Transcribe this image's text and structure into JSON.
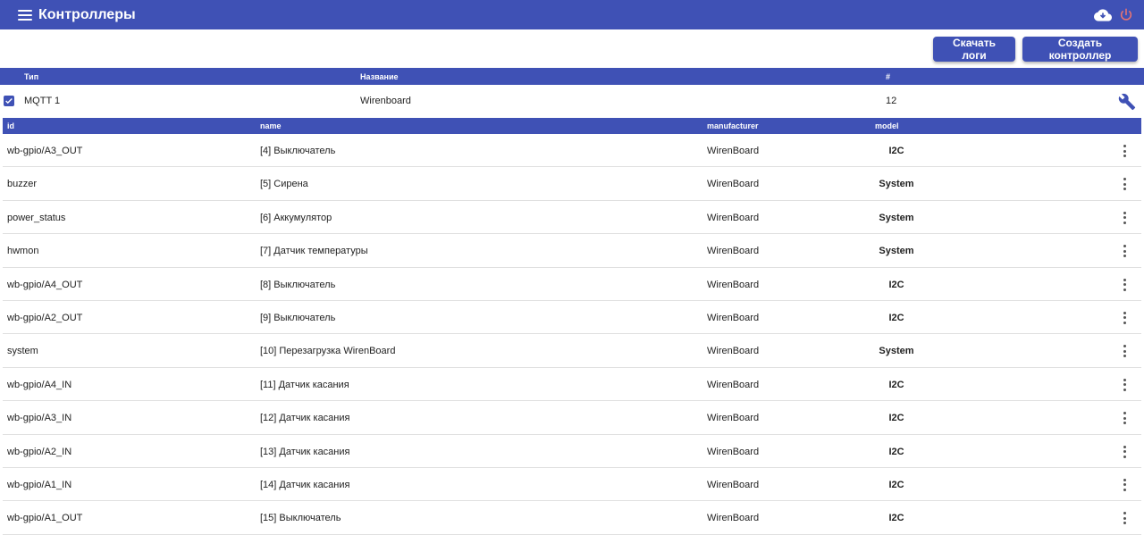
{
  "appbar": {
    "title": "Контроллеры",
    "icons": [
      "menu-icon",
      "cloud-download-icon",
      "power-icon"
    ],
    "colors": {
      "primary": "#3f51b5",
      "power": "#e57373"
    }
  },
  "toolbar": {
    "download_logs_label": "Скачать логи",
    "create_controller_label": "Создать контроллер"
  },
  "controllers": {
    "headers": {
      "type": "Тип",
      "name": "Название",
      "number": "#"
    },
    "rows": [
      {
        "checked": true,
        "type": "MQTT 1",
        "name": "Wirenboard",
        "number": "12",
        "action_icon": "wrench-icon"
      }
    ]
  },
  "devices": {
    "headers": {
      "id": "id",
      "name": "name",
      "manufacturer": "manufacturer",
      "model": "model"
    },
    "rows": [
      {
        "id": "wb-gpio/A3_OUT",
        "name": "[4] Выключатель",
        "manufacturer": "WirenBoard",
        "model": "I2C"
      },
      {
        "id": "buzzer",
        "name": "[5] Сирена",
        "manufacturer": "WirenBoard",
        "model": "System"
      },
      {
        "id": "power_status",
        "name": "[6] Аккумулятор",
        "manufacturer": "WirenBoard",
        "model": "System"
      },
      {
        "id": "hwmon",
        "name": "[7] Датчик температуры",
        "manufacturer": "WirenBoard",
        "model": "System"
      },
      {
        "id": "wb-gpio/A4_OUT",
        "name": "[8] Выключатель",
        "manufacturer": "WirenBoard",
        "model": "I2C"
      },
      {
        "id": "wb-gpio/A2_OUT",
        "name": "[9] Выключатель",
        "manufacturer": "WirenBoard",
        "model": "I2C"
      },
      {
        "id": "system",
        "name": "[10] Перезагрузка WirenBoard",
        "manufacturer": "WirenBoard",
        "model": "System"
      },
      {
        "id": "wb-gpio/A4_IN",
        "name": "[11] Датчик касания",
        "manufacturer": "WirenBoard",
        "model": "I2C"
      },
      {
        "id": "wb-gpio/A3_IN",
        "name": "[12] Датчик касания",
        "manufacturer": "WirenBoard",
        "model": "I2C"
      },
      {
        "id": "wb-gpio/A2_IN",
        "name": "[13] Датчик касания",
        "manufacturer": "WirenBoard",
        "model": "I2C"
      },
      {
        "id": "wb-gpio/A1_IN",
        "name": "[14] Датчик касания",
        "manufacturer": "WirenBoard",
        "model": "I2C"
      },
      {
        "id": "wb-gpio/A1_OUT",
        "name": "[15] Выключатель",
        "manufacturer": "WirenBoard",
        "model": "I2C"
      }
    ]
  }
}
